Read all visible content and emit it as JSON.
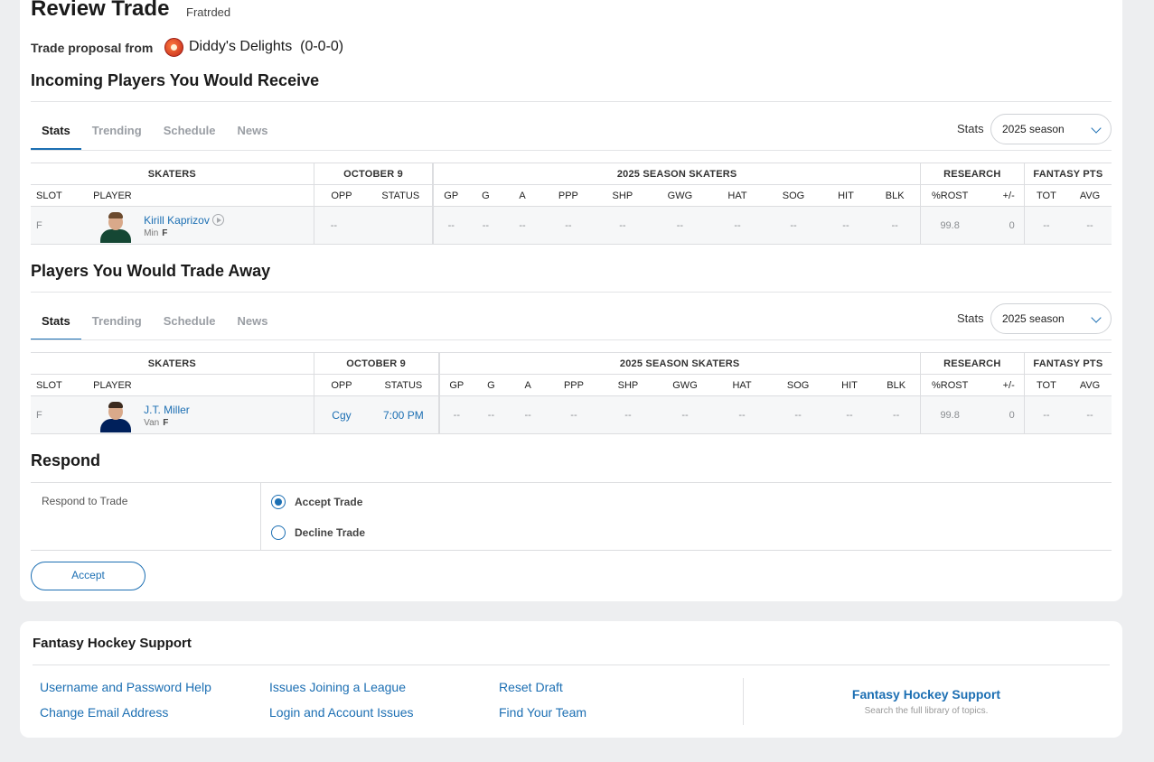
{
  "header": {
    "title": "Review Trade",
    "league": "Fratrded",
    "proposal_label": "Trade proposal from",
    "team_name": "Diddy's Delights",
    "team_record": "(0-0-0)"
  },
  "incoming": {
    "heading": "Incoming Players You Would Receive",
    "tabs": [
      "Stats",
      "Trending",
      "Schedule",
      "News"
    ],
    "stats_label": "Stats",
    "season_select": "2025 season",
    "groups": {
      "skaters": "SKATERS",
      "date": "OCTOBER 9",
      "season": "2025 SEASON SKATERS",
      "research": "RESEARCH",
      "fantasy": "FANTASY PTS"
    },
    "columns": [
      "SLOT",
      "PLAYER",
      "OPP",
      "STATUS",
      "GP",
      "G",
      "A",
      "PPP",
      "SHP",
      "GWG",
      "HAT",
      "SOG",
      "HIT",
      "BLK",
      "%ROST",
      "+/-",
      "TOT",
      "AVG"
    ],
    "player": {
      "slot": "F",
      "name": "Kirill Kaprizov",
      "team": "Min",
      "pos": "F",
      "opp": "--",
      "status": "",
      "stats": [
        "--",
        "--",
        "--",
        "--",
        "--",
        "--",
        "--",
        "--",
        "--",
        "--"
      ],
      "rost": "99.8",
      "plusminus": "0",
      "tot": "--",
      "avg": "--"
    }
  },
  "outgoing": {
    "heading": "Players You Would Trade Away",
    "tabs": [
      "Stats",
      "Trending",
      "Schedule",
      "News"
    ],
    "stats_label": "Stats",
    "season_select": "2025 season",
    "groups": {
      "skaters": "SKATERS",
      "date": "OCTOBER 9",
      "season": "2025 SEASON SKATERS",
      "research": "RESEARCH",
      "fantasy": "FANTASY PTS"
    },
    "columns": [
      "SLOT",
      "PLAYER",
      "OPP",
      "STATUS",
      "GP",
      "G",
      "A",
      "PPP",
      "SHP",
      "GWG",
      "HAT",
      "SOG",
      "HIT",
      "BLK",
      "%ROST",
      "+/-",
      "TOT",
      "AVG"
    ],
    "player": {
      "slot": "F",
      "name": "J.T. Miller",
      "team": "Van",
      "pos": "F",
      "opp": "Cgy",
      "status": "7:00 PM",
      "stats": [
        "--",
        "--",
        "--",
        "--",
        "--",
        "--",
        "--",
        "--",
        "--",
        "--"
      ],
      "rost": "99.8",
      "plusminus": "0",
      "tot": "--",
      "avg": "--"
    }
  },
  "respond": {
    "heading": "Respond",
    "label": "Respond to Trade",
    "options": [
      "Accept Trade",
      "Decline Trade"
    ],
    "selected": "Accept Trade",
    "button": "Accept"
  },
  "support": {
    "title": "Fantasy Hockey Support",
    "links": [
      [
        "Username and Password Help",
        "Change Email Address"
      ],
      [
        "Issues Joining a League",
        "Login and Account Issues"
      ],
      [
        "Reset Draft",
        "Find Your Team"
      ]
    ],
    "right_title": "Fantasy Hockey Support",
    "right_sub": "Search the full library of topics."
  },
  "colors": {
    "accent": "#1c6fb3",
    "background": "#edeef0",
    "wild_jersey": "#154734",
    "canucks_jersey": "#00205b"
  },
  "icons": [
    "team-logo-icon",
    "play-icon",
    "chevron-down-icon",
    "radio-icon"
  ]
}
